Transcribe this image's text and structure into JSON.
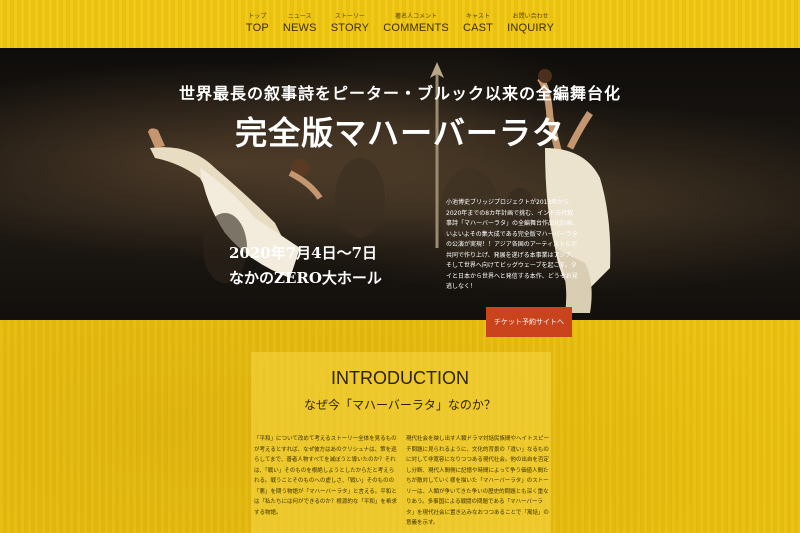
{
  "nav": {
    "items": [
      {
        "jp": "トップ",
        "en": "TOP"
      },
      {
        "jp": "ニュース",
        "en": "NEWS"
      },
      {
        "jp": "ストーリー",
        "en": "STORY"
      },
      {
        "jp": "著名人コメント",
        "en": "COMMENTS"
      },
      {
        "jp": "キャスト",
        "en": "CAST"
      },
      {
        "jp": "お問い合わせ",
        "en": "INQUIRY"
      }
    ]
  },
  "hero": {
    "tagline": "世界最長の叙事詩をピーター・ブルック以来の全編舞台化",
    "title": "完全版マハーバーラタ",
    "date": "2020年7月4日〜7日",
    "venue": "なかのZERO大ホール",
    "description": "小池博史ブリッジプロジェクトが2013年から2020年までの8カ年計画で挑む、インド古代叙事詩「マハーバーラタ」の全編舞台作品化計画、いよいよその集大成である完全版マハーバーラタの公演が実現！！アジア各国のアーティストらが共同で作り上げ、発展を遂げる本事業はアジア、そして世界へ向けてビッグウェーブを起こす。タイと日本から世界へと発信する本作、どうぞお見逃しなく！"
  },
  "ticket": {
    "label": "チケット予約サイトへ"
  },
  "intro": {
    "title": "INTRODUCTION",
    "subtitle": "なぜ今「マハーバーラタ」なのか？",
    "left_text": "「平和」について改めて考えるストーリー全体を見るものが考えるとすれば、なぜ彼方はあのクリシュナは、策を巡らしてまで、善者人物すべてを滅ぼうと導いたのか？それは、「戦い」そのものを根絶しようとしたからだと考えられる。戦うことそのものへの虚しさ、「戦い」そのものの「悪」を問う物語が「マハーバーラタ」と言える。平和とは「私たちには何ができるのか？根源的な「平和」を希求する物語。",
    "right_text": "現代社会を映し出す人類ドラマ対話民族間やヘイトスピーチ問題に見られるように、文化的背景の「違い」なるものに対して非寛容になりつつある現代社会。他の出自を否定し分断、現代人間側に記憶や時間によって争う価値人間たちが敵対していく様を描いた「マハーバーラタ」のストーリーは、人類が争いてきた争いの歴史的問題とも深く重なりあう。多事国による戦闘の問題である「マハーバーラタ」を現代社会に置き込みなおつつあることで「寓話」の意義を示す。"
  },
  "colors": {
    "background": "#f1c712",
    "hero": "#151210",
    "ticket_button": "#c9441c",
    "text_dark": "#3b2c00"
  }
}
